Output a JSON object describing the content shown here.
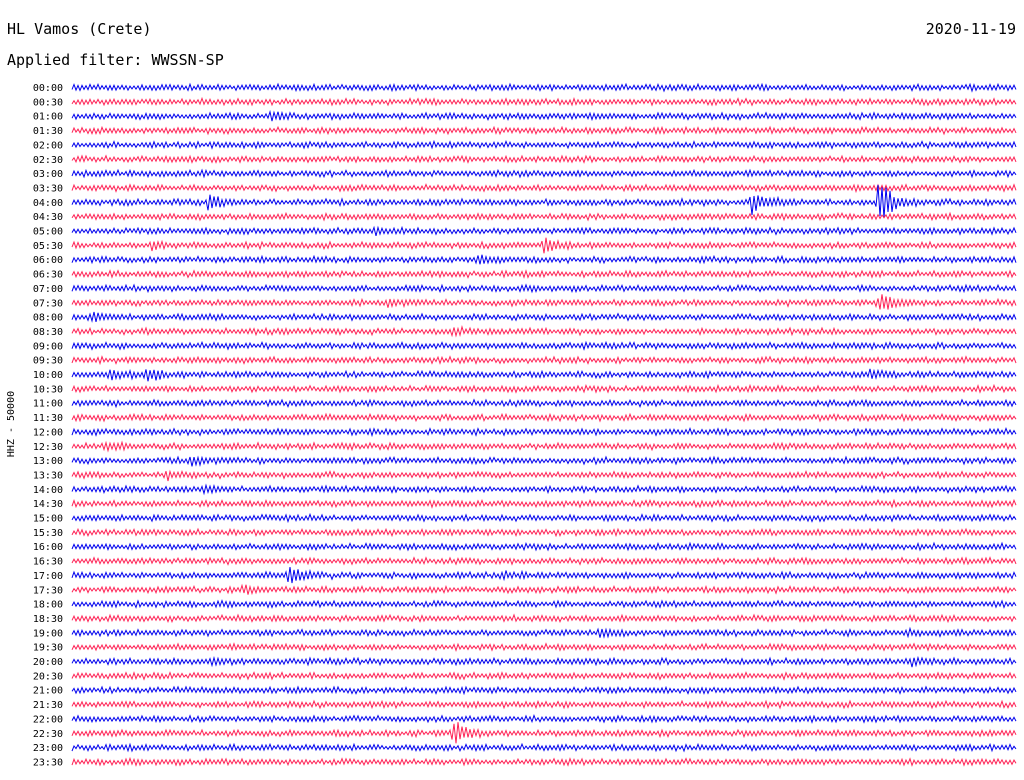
{
  "header": {
    "station": "HL Vamos (Crete)",
    "date": "2020-11-19",
    "filter": "Applied filter: WWSSN-SP"
  },
  "channel_label": "HHZ - 50000",
  "colors": {
    "trace_a": "#0000ee",
    "trace_b": "#ff2255"
  },
  "chart_data": {
    "type": "line",
    "subtype": "helicorder",
    "row_labels": [
      "00:00",
      "00:30",
      "01:00",
      "01:30",
      "02:00",
      "02:30",
      "03:00",
      "03:30",
      "04:00",
      "04:30",
      "05:00",
      "05:30",
      "06:00",
      "06:30",
      "07:00",
      "07:30",
      "08:00",
      "08:30",
      "09:00",
      "09:30",
      "10:00",
      "10:30",
      "11:00",
      "11:30",
      "12:00",
      "12:30",
      "13:00",
      "13:30",
      "14:00",
      "14:30",
      "15:00",
      "15:30",
      "16:00",
      "16:30",
      "17:00",
      "17:30",
      "18:00",
      "18:30",
      "19:00",
      "19:30",
      "20:00",
      "20:30",
      "21:00",
      "21:30",
      "22:00",
      "22:30",
      "23:00",
      "23:30"
    ],
    "row_minutes": 30,
    "series_colors": [
      "#0000ee",
      "#ff2255"
    ],
    "events": [
      {
        "row": 2,
        "x": 0.21,
        "amp": 1.0
      },
      {
        "row": 8,
        "x": 0.145,
        "amp": 2.4
      },
      {
        "row": 8,
        "x": 0.72,
        "amp": 4.5
      },
      {
        "row": 8,
        "x": 0.855,
        "amp": 9.0
      },
      {
        "row": 10,
        "x": 0.32,
        "amp": 1.1
      },
      {
        "row": 11,
        "x": 0.085,
        "amp": 1.2
      },
      {
        "row": 11,
        "x": 0.5,
        "amp": 2.6
      },
      {
        "row": 12,
        "x": 0.43,
        "amp": 1.2
      },
      {
        "row": 15,
        "x": 0.335,
        "amp": 1.0
      },
      {
        "row": 15,
        "x": 0.855,
        "amp": 3.0
      },
      {
        "row": 16,
        "x": 0.02,
        "amp": 1.0
      },
      {
        "row": 17,
        "x": 0.405,
        "amp": 0.9
      },
      {
        "row": 20,
        "x": 0.04,
        "amp": 1.8
      },
      {
        "row": 20,
        "x": 0.08,
        "amp": 2.0
      },
      {
        "row": 20,
        "x": 0.845,
        "amp": 1.3
      },
      {
        "row": 25,
        "x": 0.035,
        "amp": 1.2
      },
      {
        "row": 26,
        "x": 0.125,
        "amp": 1.6
      },
      {
        "row": 27,
        "x": 0.1,
        "amp": 1.0
      },
      {
        "row": 28,
        "x": 0.14,
        "amp": 1.0
      },
      {
        "row": 34,
        "x": 0.23,
        "amp": 3.2
      },
      {
        "row": 34,
        "x": 0.455,
        "amp": 0.9
      },
      {
        "row": 35,
        "x": 0.18,
        "amp": 0.8
      },
      {
        "row": 38,
        "x": 0.56,
        "amp": 1.1
      },
      {
        "row": 38,
        "x": 0.885,
        "amp": 1.0
      },
      {
        "row": 40,
        "x": 0.15,
        "amp": 0.8
      },
      {
        "row": 40,
        "x": 0.89,
        "amp": 1.0
      },
      {
        "row": 45,
        "x": 0.405,
        "amp": 4.0
      }
    ]
  }
}
